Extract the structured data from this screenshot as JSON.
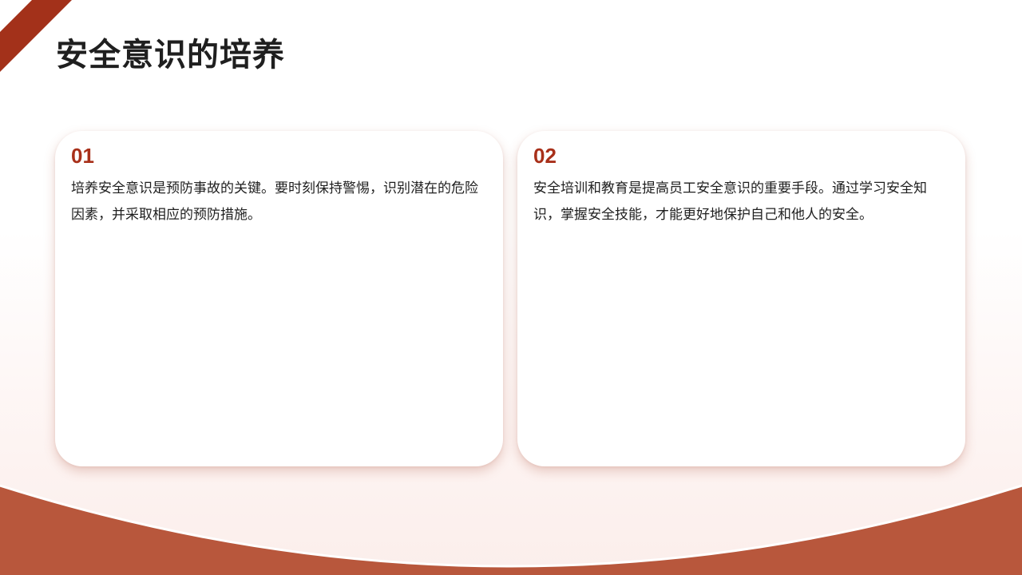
{
  "slide": {
    "title": "安全意识的培养"
  },
  "cards": [
    {
      "number": "01",
      "text": "培养安全意识是预防事故的关键。要时刻保持警惕，识别潜在的危险因素，并采取相应的预防措施。"
    },
    {
      "number": "02",
      "text": "安全培训和教育是提高员工安全意识的重要手段。通过学习安全知识，掌握安全技能，才能更好地保护自己和他人的安全。"
    }
  ],
  "colors": {
    "accent": "#a8301a",
    "wave": "#b8573c",
    "stripe": "#a3311a",
    "title_text": "#1f1f1f"
  }
}
